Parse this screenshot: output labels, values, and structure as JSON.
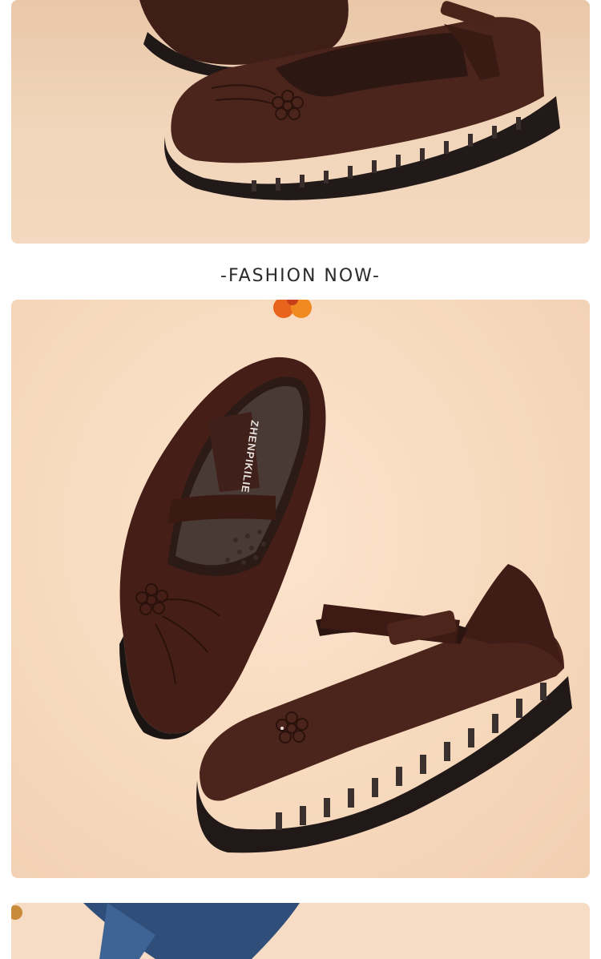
{
  "section_heading": "-FASHION NOW-",
  "insole_brand_text": "ZHENPIKILIE",
  "colors": {
    "background": "#ffffff",
    "panel": "#f6dcc4",
    "shoe_leather": "#4a231a",
    "sole": "#231c1b",
    "heading_text": "#2a2a2a"
  }
}
